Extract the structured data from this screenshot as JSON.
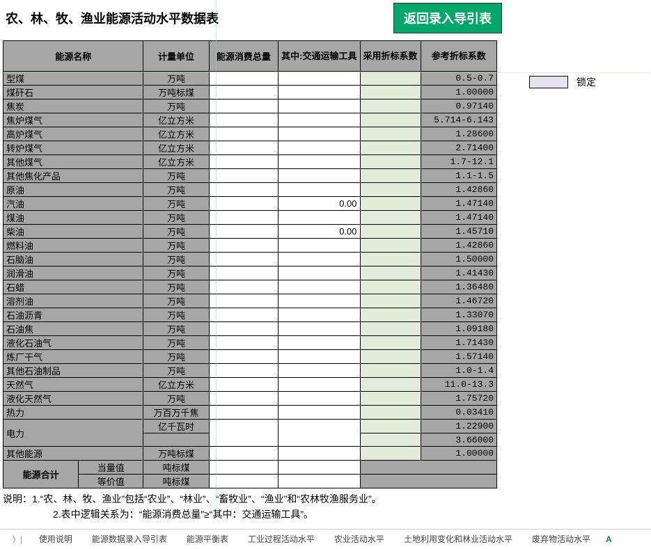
{
  "title": "农、林、牧、渔业能源活动水平数据表",
  "back_button": "返回录入导引表",
  "lock_label": "锁定",
  "headers": {
    "name": "能源名称",
    "unit": "计量单位",
    "total": "能源消费总量",
    "transport": "其中:交通运输工具",
    "adopt_coef": "采用折标系数",
    "ref_coef": "参考折标系数"
  },
  "rows": [
    {
      "name": "型煤",
      "unit": "万吨",
      "total": "",
      "transport": "",
      "adopt": "",
      "ref": "0.5-0.7"
    },
    {
      "name": "煤矸石",
      "unit": "万吨标煤",
      "total": "",
      "transport": "",
      "adopt": "",
      "ref": "1.00000"
    },
    {
      "name": "焦炭",
      "unit": "万吨",
      "total": "",
      "transport": "",
      "adopt": "",
      "ref": "0.97140"
    },
    {
      "name": "焦炉煤气",
      "unit": "亿立方米",
      "total": "",
      "transport": "",
      "adopt": "",
      "ref": "5.714-6.143"
    },
    {
      "name": "高炉煤气",
      "unit": "亿立方米",
      "total": "",
      "transport": "",
      "adopt": "",
      "ref": "1.28600"
    },
    {
      "name": "转炉煤气",
      "unit": "亿立方米",
      "total": "",
      "transport": "",
      "adopt": "",
      "ref": "2.71400"
    },
    {
      "name": "其他煤气",
      "unit": "亿立方米",
      "total": "",
      "transport": "",
      "adopt": "",
      "ref": "1.7-12.1"
    },
    {
      "name": "其他焦化产品",
      "unit": "万吨",
      "total": "",
      "transport": "",
      "adopt": "",
      "ref": "1.1-1.5"
    },
    {
      "name": "原油",
      "unit": "万吨",
      "total": "",
      "transport": "",
      "adopt": "",
      "ref": "1.42860"
    },
    {
      "name": "汽油",
      "unit": "万吨",
      "total": "",
      "transport": "0.00",
      "adopt": "",
      "ref": "1.47140"
    },
    {
      "name": "煤油",
      "unit": "万吨",
      "total": "",
      "transport": "",
      "adopt": "",
      "ref": "1.47140"
    },
    {
      "name": "柴油",
      "unit": "万吨",
      "total": "",
      "transport": "0.00",
      "adopt": "",
      "ref": "1.45710"
    },
    {
      "name": "燃料油",
      "unit": "万吨",
      "total": "",
      "transport": "",
      "adopt": "",
      "ref": "1.42860"
    },
    {
      "name": "石脑油",
      "unit": "万吨",
      "total": "",
      "transport": "",
      "adopt": "",
      "ref": "1.50000"
    },
    {
      "name": "润滑油",
      "unit": "万吨",
      "total": "",
      "transport": "",
      "adopt": "",
      "ref": "1.41430"
    },
    {
      "name": "石蜡",
      "unit": "万吨",
      "total": "",
      "transport": "",
      "adopt": "",
      "ref": "1.36480"
    },
    {
      "name": "溶剂油",
      "unit": "万吨",
      "total": "",
      "transport": "",
      "adopt": "",
      "ref": "1.46720"
    },
    {
      "name": "石油沥青",
      "unit": "万吨",
      "total": "",
      "transport": "",
      "adopt": "",
      "ref": "1.33070"
    },
    {
      "name": "石油焦",
      "unit": "万吨",
      "total": "",
      "transport": "",
      "adopt": "",
      "ref": "1.09180"
    },
    {
      "name": "液化石油气",
      "unit": "万吨",
      "total": "",
      "transport": "",
      "adopt": "",
      "ref": "1.71430"
    },
    {
      "name": "炼厂干气",
      "unit": "万吨",
      "total": "",
      "transport": "",
      "adopt": "",
      "ref": "1.57140"
    },
    {
      "name": "其他石油制品",
      "unit": "万吨",
      "total": "",
      "transport": "",
      "adopt": "",
      "ref": "1.0-1.4"
    },
    {
      "name": "天然气",
      "unit": "亿立方米",
      "total": "",
      "transport": "",
      "adopt": "",
      "ref": "11.0-13.3"
    },
    {
      "name": "液化天然气",
      "unit": "万吨",
      "total": "",
      "transport": "",
      "adopt": "",
      "ref": "1.75720"
    },
    {
      "name": "热力",
      "unit": "万百万千焦",
      "total": "",
      "transport": "",
      "adopt": "",
      "ref": "0.03410"
    }
  ],
  "electricity": {
    "name": "电力",
    "unit": "亿千瓦时",
    "ref1": "1.22900",
    "ref2": "3.66000"
  },
  "other_energy": {
    "name": "其他能源",
    "unit": "万吨标煤",
    "ref": "1.00000"
  },
  "summary": {
    "label": "能源合计",
    "equiv": "当量值",
    "price": "等价值",
    "unit": "吨标煤"
  },
  "notes": {
    "line1": "说明：1.“农、林、牧、渔业”包括“农业”、“林业”、“畜牧业”、“渔业”和“农林牧渔服务业”。",
    "line2": "2.表中逻辑关系为：“能源消费总量”≥“其中：交通运输工具”。"
  },
  "tabs": {
    "t1": "使用说明",
    "t2": "能源数据录入导引表",
    "t3": "能源平衡表",
    "t4": "工业过程活动水平",
    "t5": "农业活动水平",
    "t6": "土地利用变化和林业活动水平",
    "t7": "废弃物活动水平",
    "tA": "A"
  }
}
